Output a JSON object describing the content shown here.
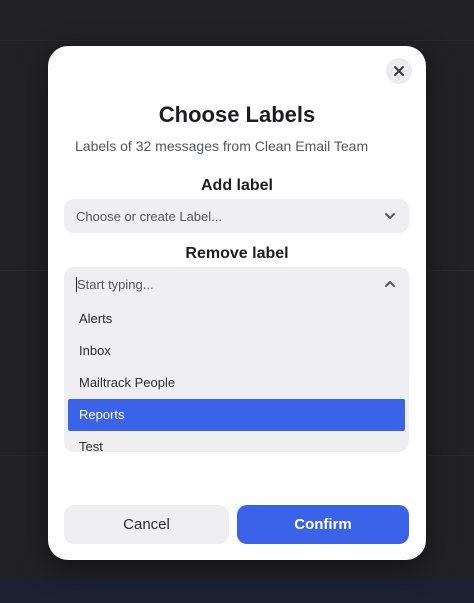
{
  "modal": {
    "title": "Choose Labels",
    "subtitle": "Labels of 32 messages from Clean Email Team",
    "close_icon": "close-icon"
  },
  "add_label": {
    "heading": "Add label",
    "placeholder": "Choose or create Label...",
    "icon": "chevron-down-icon"
  },
  "remove_label": {
    "heading": "Remove label",
    "search_placeholder": "Start typing...",
    "icon": "chevron-up-icon",
    "options": [
      {
        "label": "Alerts"
      },
      {
        "label": "Inbox"
      },
      {
        "label": "Mailtrack People"
      },
      {
        "label": "Reports"
      },
      {
        "label": "Test"
      }
    ],
    "selected": "Reports"
  },
  "footer": {
    "cancel_label": "Cancel",
    "confirm_label": "Confirm"
  },
  "colors": {
    "accent": "#3b63e9",
    "overlay": "#222224",
    "field_bg": "#efeff2"
  }
}
